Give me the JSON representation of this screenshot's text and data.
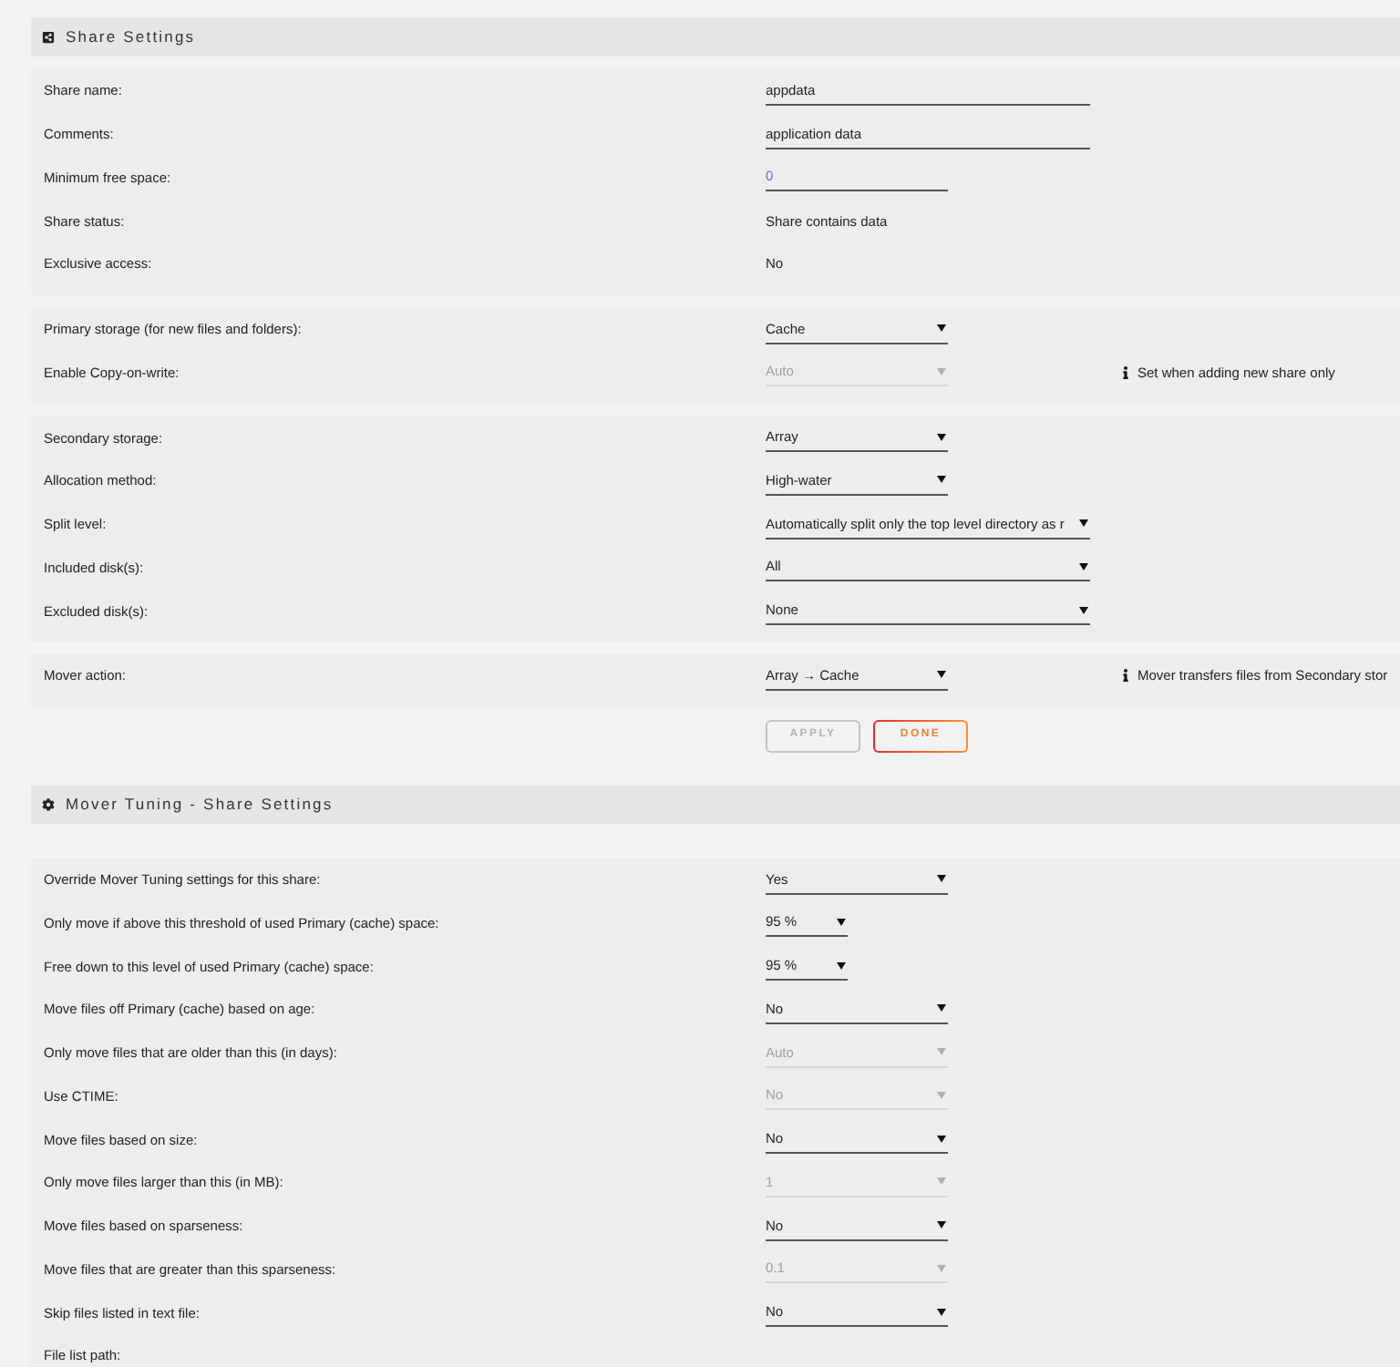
{
  "share_settings": {
    "title": "Share Settings",
    "panels": [
      {
        "rows": [
          {
            "label": "Share name:",
            "field": {
              "kind": "text",
              "value": "appdata",
              "disabled": false
            }
          },
          {
            "label": "Comments:",
            "field": {
              "kind": "text",
              "value": "application data",
              "disabled": false
            }
          },
          {
            "label": "Minimum free space:",
            "field": {
              "kind": "number",
              "value": "0",
              "disabled": false
            }
          },
          {
            "label": "Share status:",
            "field": {
              "kind": "static",
              "value": "Share contains data",
              "disabled": false
            }
          },
          {
            "label": "Exclusive access:",
            "field": {
              "kind": "static",
              "value": "No",
              "disabled": false
            }
          }
        ]
      },
      {
        "rows": [
          {
            "label": "Primary storage (for new files and folders):",
            "field": {
              "kind": "select",
              "value": "Cache",
              "disabled": false
            }
          },
          {
            "label": "Enable Copy-on-write:",
            "field": {
              "kind": "select",
              "value": "Auto",
              "disabled": true
            },
            "note": "Set when adding new share only"
          }
        ]
      },
      {
        "rows": [
          {
            "label": "Secondary storage:",
            "field": {
              "kind": "select",
              "value": "Array",
              "disabled": false
            }
          },
          {
            "label": "Allocation method:",
            "field": {
              "kind": "select",
              "value": "High-water",
              "disabled": false
            }
          },
          {
            "label": "Split level:",
            "field": {
              "kind": "longselect",
              "value": "Automatically split only the top level directory as r",
              "disabled": false
            }
          },
          {
            "label": "Included disk(s):",
            "field": {
              "kind": "longselect",
              "value": "All",
              "disabled": false
            }
          },
          {
            "label": "Excluded disk(s):",
            "field": {
              "kind": "longselect",
              "value": "None",
              "disabled": false
            }
          }
        ]
      },
      {
        "rows": [
          {
            "label": "Mover action:",
            "field": {
              "kind": "select",
              "value": "Array → Cache",
              "disabled": false
            },
            "note": "Mover transfers files from Secondary stor"
          }
        ]
      }
    ],
    "buttons": [
      {
        "label": "APPLY",
        "disabled": true
      },
      {
        "label": "DONE",
        "disabled": false
      }
    ]
  },
  "mover_tuning": {
    "title": "Mover Tuning - Share Settings",
    "panels": [
      {
        "rows": [
          {
            "label": "Override Mover Tuning settings for this share:",
            "field": {
              "kind": "select",
              "value": "Yes",
              "disabled": false
            }
          },
          {
            "label": "Only move if above this threshold of used Primary (cache) space:",
            "field": {
              "kind": "percent",
              "value": "95 %",
              "disabled": false
            }
          },
          {
            "label": "Free down to this level of used Primary (cache) space:",
            "field": {
              "kind": "percent",
              "value": "95 %",
              "disabled": false
            }
          },
          {
            "label": "Move files off Primary (cache) based on age:",
            "field": {
              "kind": "select",
              "value": "No",
              "disabled": false
            }
          },
          {
            "label": "Only move files that are older than this (in days):",
            "field": {
              "kind": "select",
              "value": "Auto",
              "disabled": true
            }
          },
          {
            "label": "Use CTIME:",
            "field": {
              "kind": "select",
              "value": "No",
              "disabled": true
            }
          },
          {
            "label": "Move files based on size:",
            "field": {
              "kind": "select",
              "value": "No",
              "disabled": false
            }
          },
          {
            "label": "Only move files larger than this (in MB):",
            "field": {
              "kind": "select",
              "value": "1",
              "disabled": true
            }
          },
          {
            "label": "Move files based on sparseness:",
            "field": {
              "kind": "select",
              "value": "No",
              "disabled": false
            }
          },
          {
            "label": "Move files that are greater than this sparseness:",
            "field": {
              "kind": "select",
              "value": "0.1",
              "disabled": true
            }
          },
          {
            "label": "Skip files listed in text file:",
            "field": {
              "kind": "select",
              "value": "No",
              "disabled": false
            }
          },
          {
            "label": "File list path:"
          }
        ]
      }
    ]
  }
}
